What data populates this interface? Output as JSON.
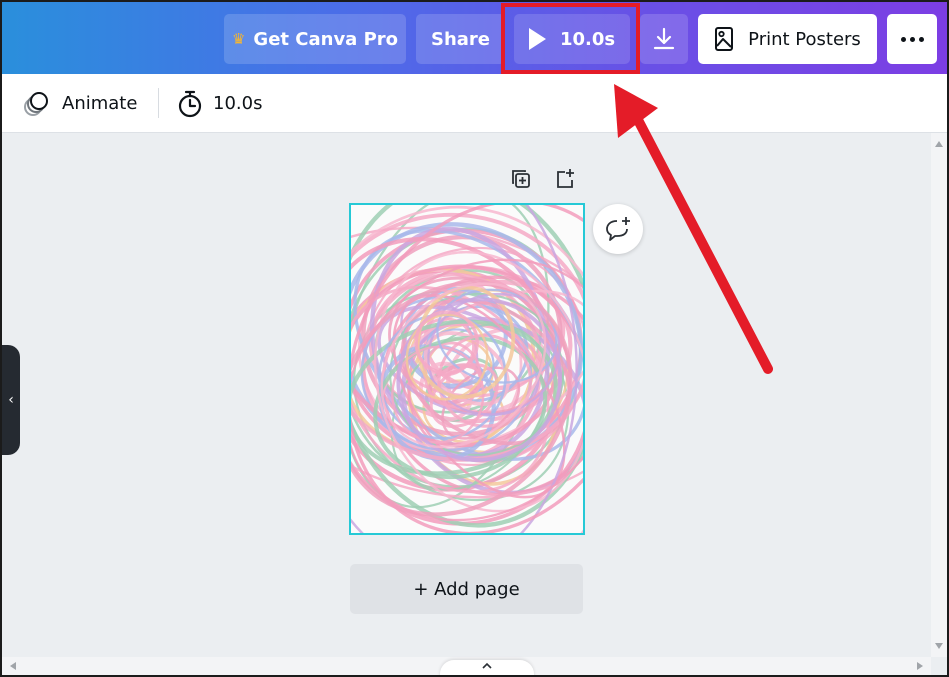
{
  "header": {
    "get_pro_label": "Get Canva Pro",
    "share_label": "Share",
    "play_duration": "10.0s",
    "print_label": "Print Posters"
  },
  "toolbar": {
    "animate_label": "Animate",
    "timer_value": "10.0s"
  },
  "canvas": {
    "add_page_label": "+ Add page"
  },
  "colors": {
    "header_gradient_start": "#2a8fdc",
    "header_gradient_end": "#7c3ee4",
    "highlight": "#e41c28",
    "page_selection": "#26c9d6"
  },
  "icons": [
    "crown-icon",
    "play-icon",
    "download-icon",
    "print-poster-icon",
    "more-icon",
    "animate-icon",
    "timer-icon",
    "duplicate-page-icon",
    "add-page-icon",
    "comment-add-icon",
    "chevron-left-icon",
    "chevron-up-icon"
  ]
}
